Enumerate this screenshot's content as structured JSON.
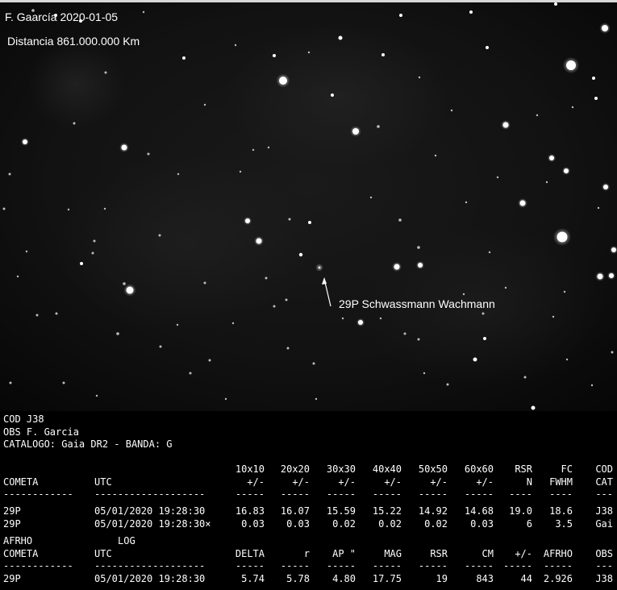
{
  "image": {
    "observer_caption": "F. Gaarcía  2020-01-05",
    "distance_caption": "Distancia 861.000.000 Km",
    "target_label": "29P Schwassmann Wachmann"
  },
  "header_lines": [
    "COD J38",
    "OBS F. Garcia",
    "CATALOGO: Gaia DR2 - BANDA: G"
  ],
  "table1": {
    "head_top": [
      "",
      "",
      "10x10",
      "20x20",
      "30x30",
      "40x40",
      "50x50",
      "60x60",
      "RSR",
      "FC",
      "COD"
    ],
    "head_bottom": [
      "COMETA",
      "UTC",
      "+/-",
      "+/-",
      "+/-",
      "+/-",
      "+/-",
      "+/-",
      "N",
      "FWHM",
      "CAT"
    ],
    "rule": [
      "------------",
      "-------------------",
      "-----",
      "-----",
      "-----",
      "-----",
      "-----",
      "-----",
      "----",
      "----",
      "---"
    ],
    "rows": [
      [
        "29P",
        "05/01/2020 19:28:30",
        "16.83",
        "16.07",
        "15.59",
        "15.22",
        "14.92",
        "14.68",
        "19.0",
        "18.6",
        "J38"
      ],
      [
        "29P",
        "05/01/2020 19:28:30×",
        "0.03",
        "0.03",
        "0.02",
        "0.02",
        "0.02",
        "0.03",
        "6",
        "3.5",
        "Gai"
      ]
    ]
  },
  "table2": {
    "head_top": [
      "AFRHO",
      "LOG"
    ],
    "head_bottom": [
      "COMETA",
      "UTC",
      "DELTA",
      "r",
      "AP \"",
      "MAG",
      "RSR",
      "CM",
      "+/-",
      "AFRHO",
      "OBS"
    ],
    "rule": [
      "------------",
      "-------------------",
      "-----",
      "-----",
      "-----",
      "-----",
      "-----",
      "-----",
      "-----",
      "-----",
      "---"
    ],
    "rows": [
      [
        "29P",
        "05/01/2020 19:28:30",
        "5.74",
        "5.78",
        "4.80",
        "17.75",
        "19",
        "843",
        "44",
        "2.926",
        "J38"
      ]
    ]
  }
}
